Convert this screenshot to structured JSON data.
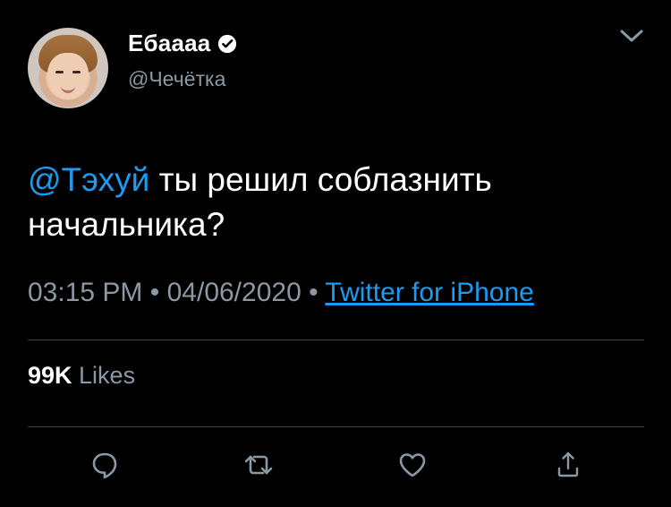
{
  "colors": {
    "background": "#000000",
    "accent": "#1d9bf0",
    "muted": "#8b98a5",
    "divider": "#38444d"
  },
  "author": {
    "name": "Ебаааа",
    "handle": "@Чечётка",
    "verified": true,
    "avatar_icon": "profile-photo"
  },
  "tweet": {
    "mention": "@Тэхуй",
    "text": " ты решил соблазнить начальника?"
  },
  "meta": {
    "time": "03:15 PM",
    "separator": " • ",
    "date": "04/06/2020",
    "source": "Twitter for iPhone"
  },
  "stats": {
    "likes_count": "99K",
    "likes_label": " Likes"
  },
  "actions": [
    {
      "name": "reply",
      "icon": "reply-icon"
    },
    {
      "name": "retweet",
      "icon": "retweet-icon"
    },
    {
      "name": "like",
      "icon": "heart-icon"
    },
    {
      "name": "share",
      "icon": "share-icon"
    }
  ]
}
